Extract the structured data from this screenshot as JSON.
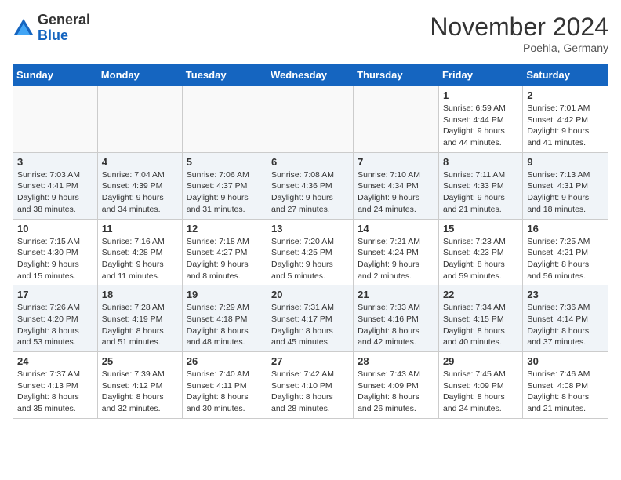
{
  "header": {
    "logo_line1": "General",
    "logo_line2": "Blue",
    "month": "November 2024",
    "location": "Poehla, Germany"
  },
  "days_of_week": [
    "Sunday",
    "Monday",
    "Tuesday",
    "Wednesday",
    "Thursday",
    "Friday",
    "Saturday"
  ],
  "weeks": [
    [
      {
        "day": "",
        "info": ""
      },
      {
        "day": "",
        "info": ""
      },
      {
        "day": "",
        "info": ""
      },
      {
        "day": "",
        "info": ""
      },
      {
        "day": "",
        "info": ""
      },
      {
        "day": "1",
        "info": "Sunrise: 6:59 AM\nSunset: 4:44 PM\nDaylight: 9 hours and 44 minutes."
      },
      {
        "day": "2",
        "info": "Sunrise: 7:01 AM\nSunset: 4:42 PM\nDaylight: 9 hours and 41 minutes."
      }
    ],
    [
      {
        "day": "3",
        "info": "Sunrise: 7:03 AM\nSunset: 4:41 PM\nDaylight: 9 hours and 38 minutes."
      },
      {
        "day": "4",
        "info": "Sunrise: 7:04 AM\nSunset: 4:39 PM\nDaylight: 9 hours and 34 minutes."
      },
      {
        "day": "5",
        "info": "Sunrise: 7:06 AM\nSunset: 4:37 PM\nDaylight: 9 hours and 31 minutes."
      },
      {
        "day": "6",
        "info": "Sunrise: 7:08 AM\nSunset: 4:36 PM\nDaylight: 9 hours and 27 minutes."
      },
      {
        "day": "7",
        "info": "Sunrise: 7:10 AM\nSunset: 4:34 PM\nDaylight: 9 hours and 24 minutes."
      },
      {
        "day": "8",
        "info": "Sunrise: 7:11 AM\nSunset: 4:33 PM\nDaylight: 9 hours and 21 minutes."
      },
      {
        "day": "9",
        "info": "Sunrise: 7:13 AM\nSunset: 4:31 PM\nDaylight: 9 hours and 18 minutes."
      }
    ],
    [
      {
        "day": "10",
        "info": "Sunrise: 7:15 AM\nSunset: 4:30 PM\nDaylight: 9 hours and 15 minutes."
      },
      {
        "day": "11",
        "info": "Sunrise: 7:16 AM\nSunset: 4:28 PM\nDaylight: 9 hours and 11 minutes."
      },
      {
        "day": "12",
        "info": "Sunrise: 7:18 AM\nSunset: 4:27 PM\nDaylight: 9 hours and 8 minutes."
      },
      {
        "day": "13",
        "info": "Sunrise: 7:20 AM\nSunset: 4:25 PM\nDaylight: 9 hours and 5 minutes."
      },
      {
        "day": "14",
        "info": "Sunrise: 7:21 AM\nSunset: 4:24 PM\nDaylight: 9 hours and 2 minutes."
      },
      {
        "day": "15",
        "info": "Sunrise: 7:23 AM\nSunset: 4:23 PM\nDaylight: 8 hours and 59 minutes."
      },
      {
        "day": "16",
        "info": "Sunrise: 7:25 AM\nSunset: 4:21 PM\nDaylight: 8 hours and 56 minutes."
      }
    ],
    [
      {
        "day": "17",
        "info": "Sunrise: 7:26 AM\nSunset: 4:20 PM\nDaylight: 8 hours and 53 minutes."
      },
      {
        "day": "18",
        "info": "Sunrise: 7:28 AM\nSunset: 4:19 PM\nDaylight: 8 hours and 51 minutes."
      },
      {
        "day": "19",
        "info": "Sunrise: 7:29 AM\nSunset: 4:18 PM\nDaylight: 8 hours and 48 minutes."
      },
      {
        "day": "20",
        "info": "Sunrise: 7:31 AM\nSunset: 4:17 PM\nDaylight: 8 hours and 45 minutes."
      },
      {
        "day": "21",
        "info": "Sunrise: 7:33 AM\nSunset: 4:16 PM\nDaylight: 8 hours and 42 minutes."
      },
      {
        "day": "22",
        "info": "Sunrise: 7:34 AM\nSunset: 4:15 PM\nDaylight: 8 hours and 40 minutes."
      },
      {
        "day": "23",
        "info": "Sunrise: 7:36 AM\nSunset: 4:14 PM\nDaylight: 8 hours and 37 minutes."
      }
    ],
    [
      {
        "day": "24",
        "info": "Sunrise: 7:37 AM\nSunset: 4:13 PM\nDaylight: 8 hours and 35 minutes."
      },
      {
        "day": "25",
        "info": "Sunrise: 7:39 AM\nSunset: 4:12 PM\nDaylight: 8 hours and 32 minutes."
      },
      {
        "day": "26",
        "info": "Sunrise: 7:40 AM\nSunset: 4:11 PM\nDaylight: 8 hours and 30 minutes."
      },
      {
        "day": "27",
        "info": "Sunrise: 7:42 AM\nSunset: 4:10 PM\nDaylight: 8 hours and 28 minutes."
      },
      {
        "day": "28",
        "info": "Sunrise: 7:43 AM\nSunset: 4:09 PM\nDaylight: 8 hours and 26 minutes."
      },
      {
        "day": "29",
        "info": "Sunrise: 7:45 AM\nSunset: 4:09 PM\nDaylight: 8 hours and 24 minutes."
      },
      {
        "day": "30",
        "info": "Sunrise: 7:46 AM\nSunset: 4:08 PM\nDaylight: 8 hours and 21 minutes."
      }
    ]
  ]
}
